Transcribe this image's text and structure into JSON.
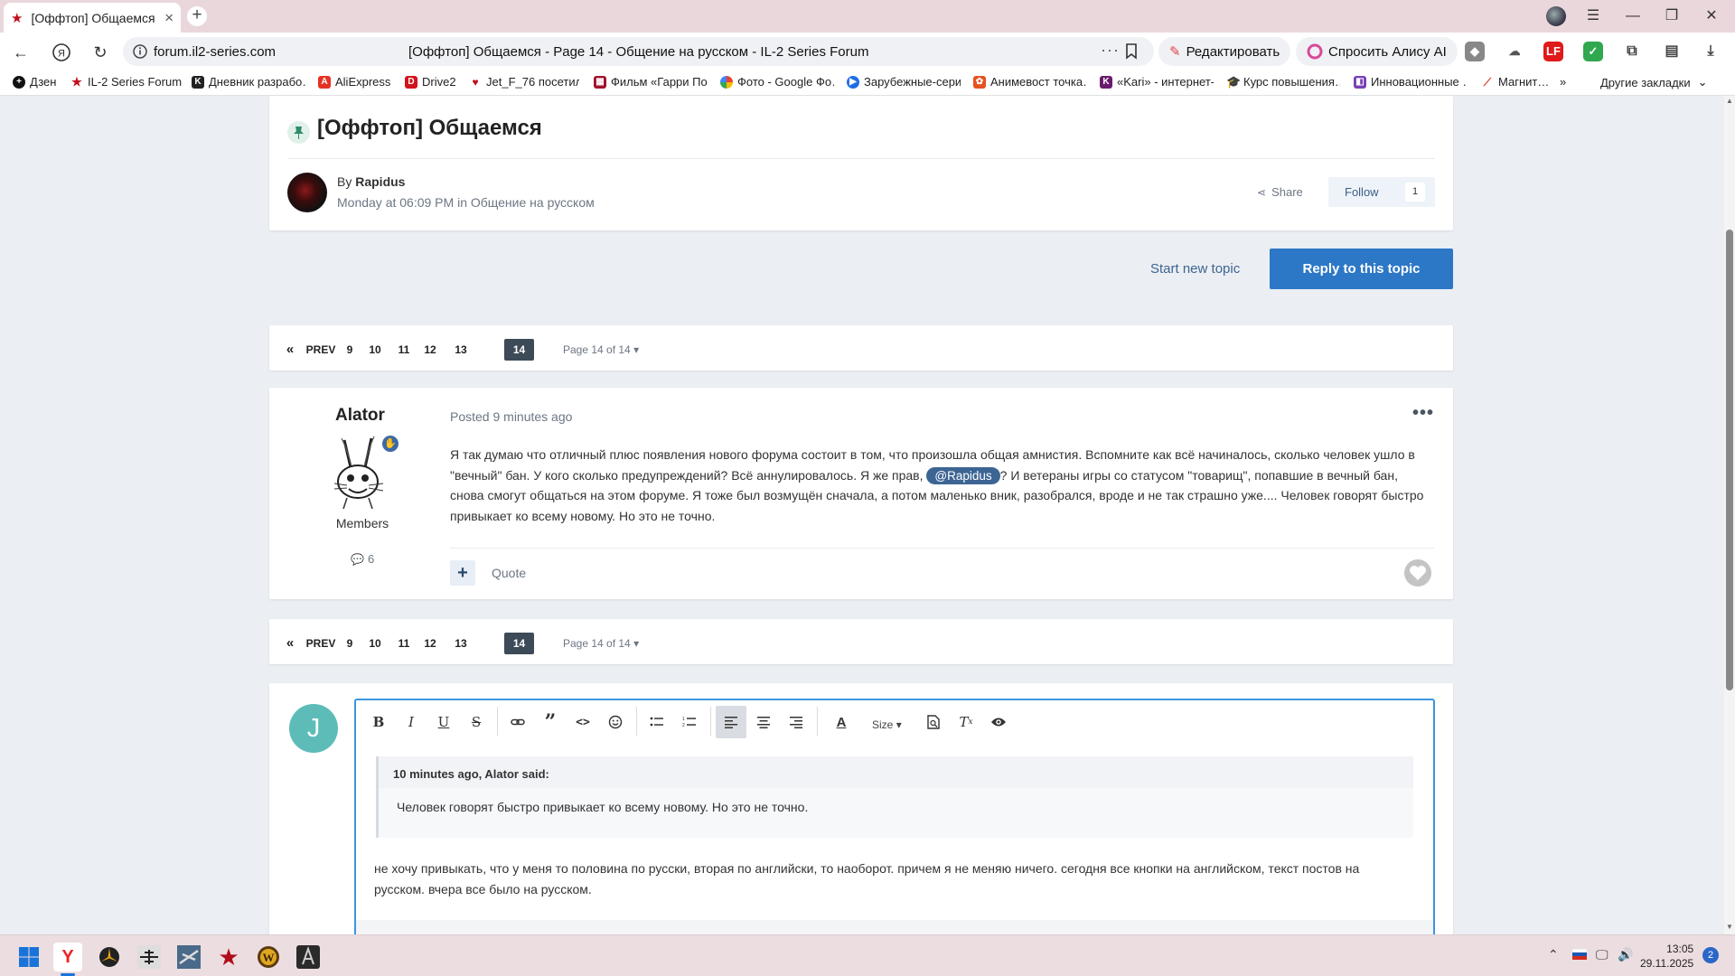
{
  "browser": {
    "tab_title": "[Оффтоп] Общаемся - ...",
    "url": "forum.il2-series.com",
    "page_title": "[Оффтоп] Общаемся - Page 14 - Общение на русском - IL-2 Series Forum",
    "edit_btn": "Редактировать",
    "alice_btn": "Спросить Алису AI",
    "ext_lf": "LF"
  },
  "bookmarks": {
    "items": [
      "Дзен",
      "IL-2 Series Forum",
      "Дневник разрабо…",
      "AliExpress",
      "Drive2",
      "Jet_F_76 посетил…",
      "Фильм «Гарри По…",
      "Фото - Google Фо…",
      "Зарубежные-сери…",
      "Анимевост точка…",
      "«Kari» - интернет-…",
      "Курс повышения…",
      "Инновационные …",
      "Магнит…"
    ],
    "more": "»",
    "other": "Другие закладки"
  },
  "topic": {
    "title": "[Оффтоп] Общаемся",
    "by_label": "By",
    "author": "Rapidus",
    "date": "Monday at 06:09 PM",
    "in_label": "in",
    "forum": "Общение на русском",
    "share": "Share",
    "follow": "Follow",
    "follow_count": "1",
    "start_new": "Start new topic",
    "reply": "Reply to this topic"
  },
  "pagination": {
    "first": "«",
    "prev": "PREV",
    "pages": [
      "9",
      "10",
      "11",
      "12",
      "13",
      "14"
    ],
    "current": "14",
    "jump": "Page 14 of 14"
  },
  "post": {
    "author": "Alator",
    "group": "Members",
    "post_count": "6",
    "posted": "Posted 9 minutes ago",
    "menu": "•••",
    "body_1": "Я так думаю что отличный плюс появления нового форума состоит в том, что произошла общая амнистия. Вспомните как всё начиналось, сколько человек ушло в \"вечный\" бан. У кого сколько предупреждений? Всё аннулировалось. Я же прав, ",
    "mention": "@Rapidus",
    "body_2": "? И ветераны  игры со статусом \"товарищ\", попавшие в вечный бан, снова смогут общаться на этом форуме.  Я тоже был возмущён сначала, а  потом маленько вник, разобрался, вроде и не так страшно уже.... Человек говорят быстро привыкает ко всему новому. Но это не точно.",
    "plus": "+",
    "quote": "Quote"
  },
  "reply": {
    "avatar_letter": "J",
    "size_label": "Size",
    "quote_cite": "10 minutes ago, Alator said:",
    "quote_text": "Человек говорят быстро привыкает ко всему новому. Но это не точно.",
    "text": "не хочу привыкать, что у меня то половина по русски, вторая по английски, то наоборот. причем я не меняю ничего. сегодня все кнопки на английском, текст постов на русском. вчера все было на русском."
  },
  "taskbar": {
    "time": "13:05",
    "date": "29.11.2025",
    "notifications": "2"
  },
  "colors": {
    "primary": "#2c78c6",
    "link": "#3d6594",
    "muted": "#6c7683",
    "page_bg": "#ebeef2",
    "editor_focus": "#3d95e0",
    "avatar_j": "#5dbcb8"
  }
}
